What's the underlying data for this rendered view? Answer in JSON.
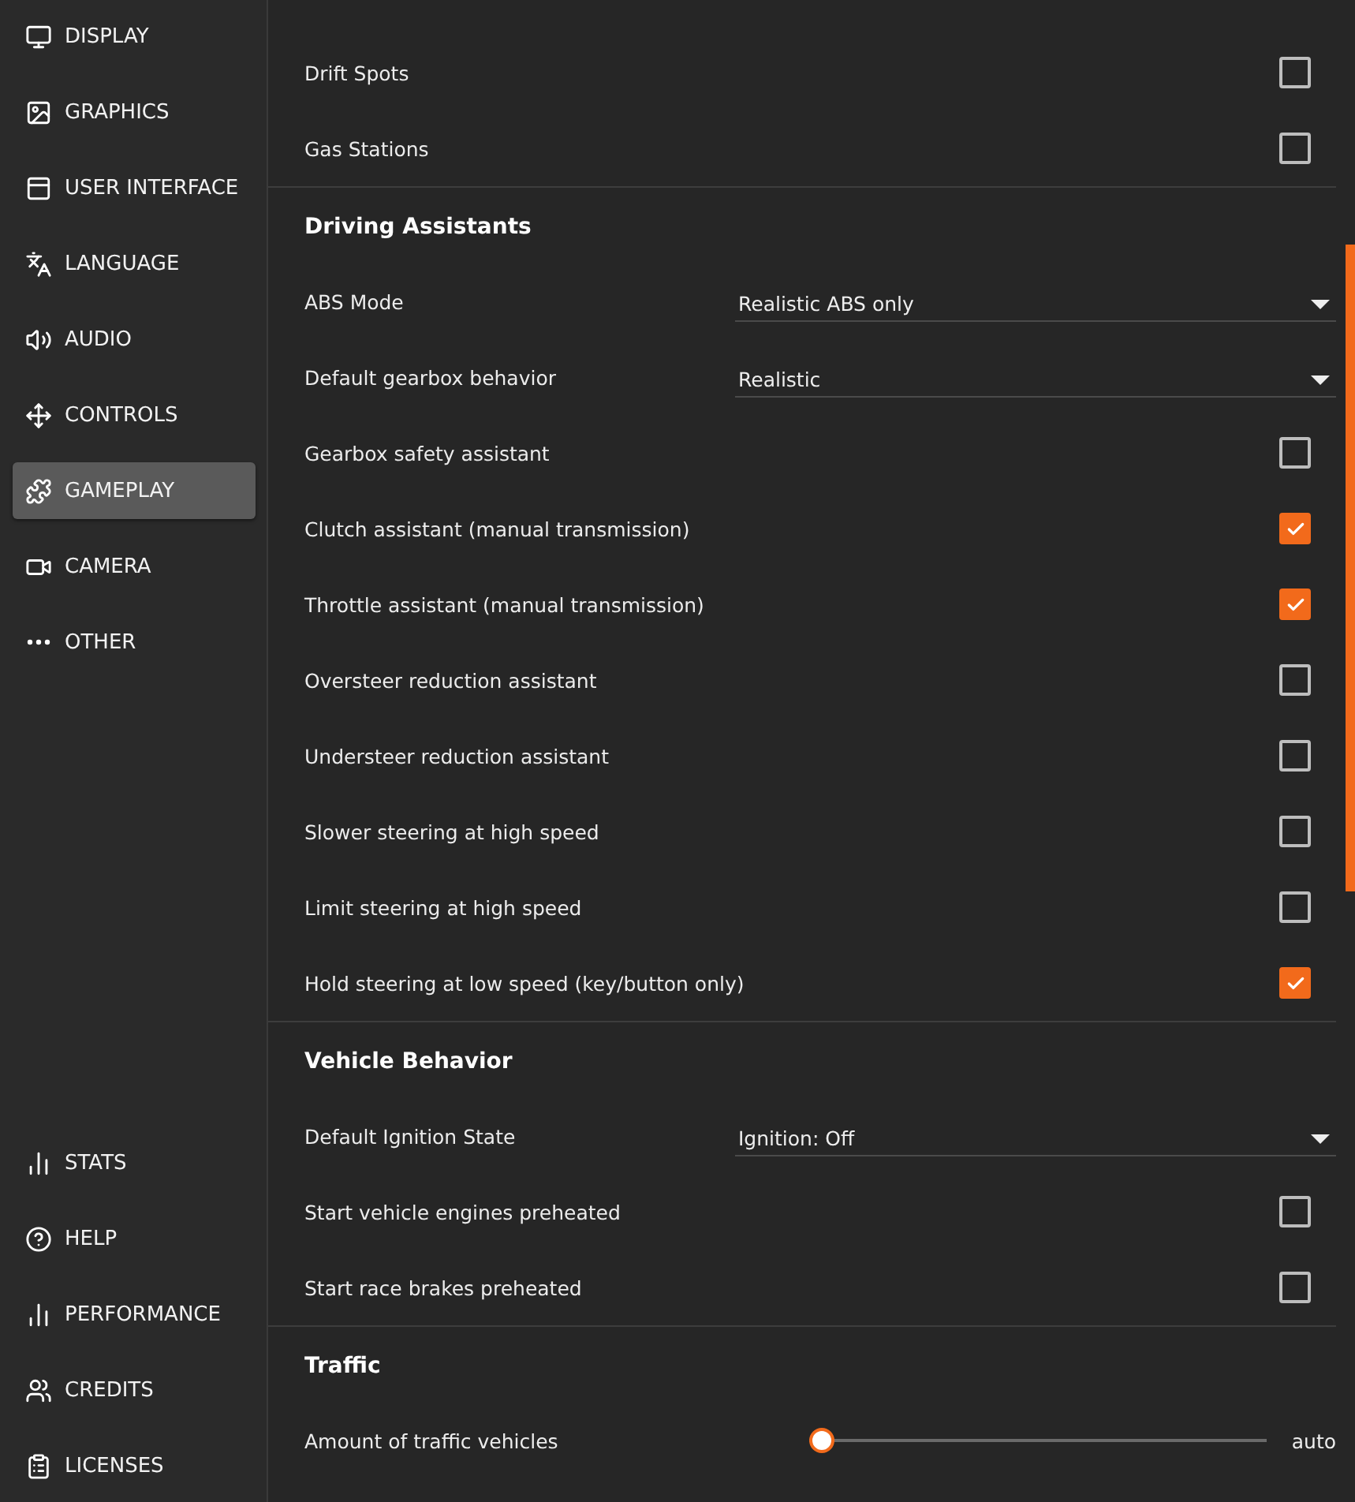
{
  "sidebar": {
    "items": [
      {
        "label": "DISPLAY",
        "selected": false
      },
      {
        "label": "GRAPHICS",
        "selected": false
      },
      {
        "label": "USER INTERFACE",
        "selected": false
      },
      {
        "label": "LANGUAGE",
        "selected": false
      },
      {
        "label": "AUDIO",
        "selected": false
      },
      {
        "label": "CONTROLS",
        "selected": false
      },
      {
        "label": "GAMEPLAY",
        "selected": true
      },
      {
        "label": "CAMERA",
        "selected": false
      },
      {
        "label": "OTHER",
        "selected": false
      }
    ],
    "bottom_items": [
      {
        "label": "STATS"
      },
      {
        "label": "HELP"
      },
      {
        "label": "PERFORMANCE"
      },
      {
        "label": "CREDITS"
      },
      {
        "label": "LICENSES"
      }
    ]
  },
  "sections": [
    {
      "rows": [
        {
          "kind": "checkbox",
          "label": "Drift Spots",
          "checked": false
        },
        {
          "kind": "checkbox",
          "label": "Gas Stations",
          "checked": false
        }
      ]
    },
    {
      "title": "Driving Assistants",
      "rows": [
        {
          "kind": "dropdown",
          "label": "ABS Mode",
          "value": "Realistic ABS only"
        },
        {
          "kind": "dropdown",
          "label": "Default gearbox behavior",
          "value": "Realistic"
        },
        {
          "kind": "checkbox",
          "label": "Gearbox safety assistant",
          "checked": false
        },
        {
          "kind": "checkbox",
          "label": "Clutch assistant (manual transmission)",
          "checked": true
        },
        {
          "kind": "checkbox",
          "label": "Throttle assistant (manual transmission)",
          "checked": true
        },
        {
          "kind": "checkbox",
          "label": "Oversteer reduction assistant",
          "checked": false
        },
        {
          "kind": "checkbox",
          "label": "Understeer reduction assistant",
          "checked": false
        },
        {
          "kind": "checkbox",
          "label": "Slower steering at high speed",
          "checked": false
        },
        {
          "kind": "checkbox",
          "label": "Limit steering at high speed",
          "checked": false
        },
        {
          "kind": "checkbox",
          "label": "Hold steering at low speed (key/button only)",
          "checked": true
        }
      ]
    },
    {
      "title": "Vehicle Behavior",
      "rows": [
        {
          "kind": "dropdown",
          "label": "Default Ignition State",
          "value": "Ignition: Off"
        },
        {
          "kind": "checkbox",
          "label": "Start vehicle engines preheated",
          "checked": false
        },
        {
          "kind": "checkbox",
          "label": "Start race brakes preheated",
          "checked": false
        }
      ]
    },
    {
      "title": "Traffic",
      "rows": [
        {
          "kind": "slider",
          "label": "Amount of traffic vehicles",
          "level": 0,
          "reading": "auto"
        }
      ]
    }
  ]
}
